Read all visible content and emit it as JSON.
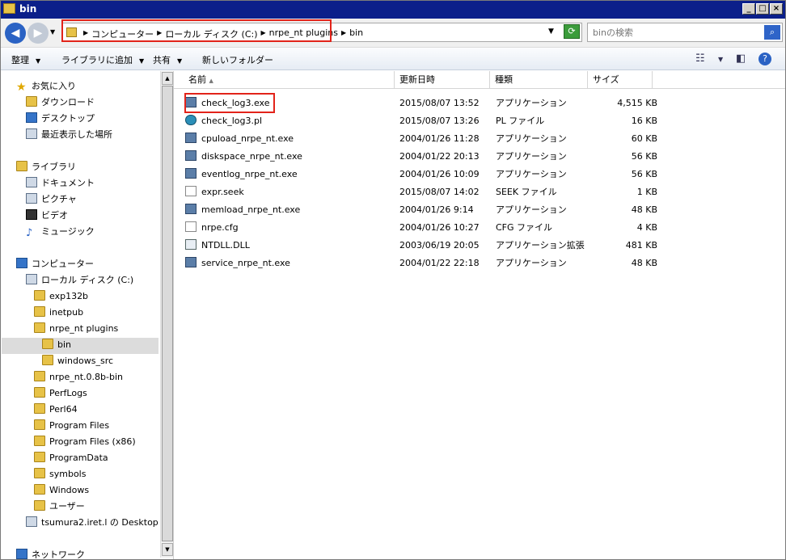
{
  "window": {
    "title": "bin"
  },
  "address": {
    "crumbs": [
      "コンピューター",
      "ローカル ディスク (C:)",
      "nrpe_nt plugins",
      "bin"
    ]
  },
  "search": {
    "placeholder": "binの検索"
  },
  "toolbar": {
    "organize": "整理",
    "add_to_library": "ライブラリに追加",
    "share": "共有",
    "new_folder": "新しいフォルダー"
  },
  "nav": {
    "favorites": "お気に入り",
    "downloads": "ダウンロード",
    "desktop": "デスクトップ",
    "recent": "最近表示した場所",
    "libraries": "ライブラリ",
    "documents": "ドキュメント",
    "pictures": "ピクチャ",
    "videos": "ビデオ",
    "music": "ミュージック",
    "computer": "コンピューター",
    "local_disk": "ローカル ディスク (C:)",
    "folders": [
      "exp132b",
      "inetpub",
      "nrpe_nt plugins",
      "bin",
      "windows_src",
      "nrpe_nt.0.8b-bin",
      "PerfLogs",
      "Perl64",
      "Program Files",
      "Program Files (x86)",
      "ProgramData",
      "symbols",
      "Windows",
      "ユーザー"
    ],
    "network_drive": "tsumura2.iret.l の Desktop",
    "network": "ネットワーク"
  },
  "columns": {
    "name": "名前",
    "date": "更新日時",
    "type": "種類",
    "size": "サイズ"
  },
  "files": [
    {
      "name": "check_log3.exe",
      "date": "2015/08/07 13:52",
      "type": "アプリケーション",
      "size": "4,515 KB",
      "icon": "app-icon"
    },
    {
      "name": "check_log3.pl",
      "date": "2015/08/07 13:26",
      "type": "PL ファイル",
      "size": "16 KB",
      "icon": "perl-icon"
    },
    {
      "name": "cpuload_nrpe_nt.exe",
      "date": "2004/01/26 11:28",
      "type": "アプリケーション",
      "size": "60 KB",
      "icon": "app-icon"
    },
    {
      "name": "diskspace_nrpe_nt.exe",
      "date": "2004/01/22 20:13",
      "type": "アプリケーション",
      "size": "56 KB",
      "icon": "app-icon"
    },
    {
      "name": "eventlog_nrpe_nt.exe",
      "date": "2004/01/26 10:09",
      "type": "アプリケーション",
      "size": "56 KB",
      "icon": "app-icon"
    },
    {
      "name": "expr.seek",
      "date": "2015/08/07 14:02",
      "type": "SEEK ファイル",
      "size": "1 KB",
      "icon": "file-icon"
    },
    {
      "name": "memload_nrpe_nt.exe",
      "date": "2004/01/26 9:14",
      "type": "アプリケーション",
      "size": "48 KB",
      "icon": "app-icon"
    },
    {
      "name": "nrpe.cfg",
      "date": "2004/01/26 10:27",
      "type": "CFG ファイル",
      "size": "4 KB",
      "icon": "file-icon"
    },
    {
      "name": "NTDLL.DLL",
      "date": "2003/06/19 20:05",
      "type": "アプリケーション拡張",
      "size": "481 KB",
      "icon": "dll-icon"
    },
    {
      "name": "service_nrpe_nt.exe",
      "date": "2004/01/22 22:18",
      "type": "アプリケーション",
      "size": "48 KB",
      "icon": "app-icon"
    }
  ]
}
